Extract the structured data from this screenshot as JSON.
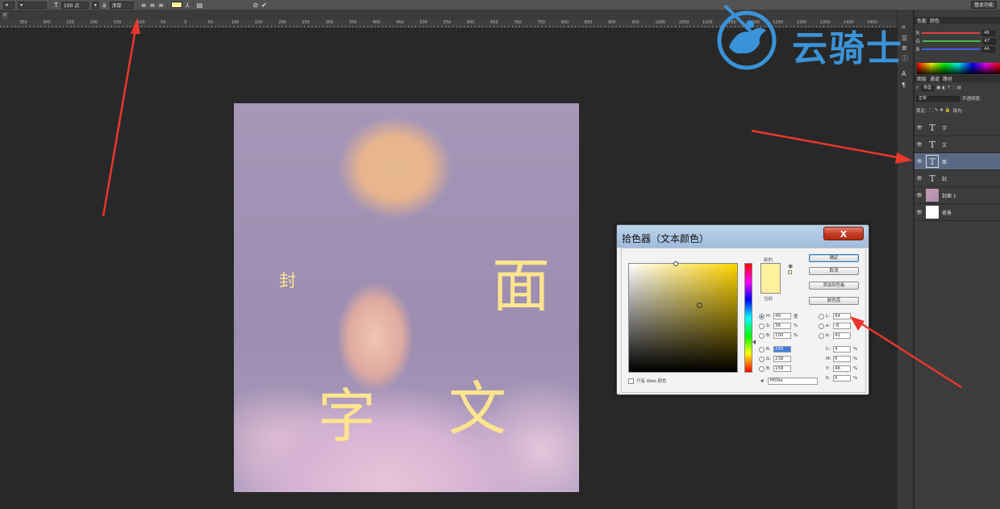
{
  "options_bar": {
    "font_size": "100 点",
    "antialias": "浑厚",
    "workspace": "基本功能",
    "text_color": "#fff09e"
  },
  "ruler": {
    "labels": [
      "350",
      "300",
      "250",
      "200",
      "150",
      "100",
      "50",
      "0",
      "50",
      "100",
      "150",
      "200",
      "250",
      "300",
      "350",
      "400",
      "450",
      "500",
      "550",
      "600",
      "650",
      "700",
      "750",
      "800",
      "850",
      "900",
      "950",
      "1000",
      "1050",
      "1100",
      "1150",
      "1200",
      "1250",
      "1300",
      "1350",
      "1400",
      "1450"
    ]
  },
  "canvas": {
    "texts": {
      "feng": "封",
      "mian": "面",
      "zi": "字",
      "wen": "文"
    },
    "text_color": "#fde48e"
  },
  "panels": {
    "top_tabs": [
      "色板",
      "颜色"
    ],
    "sliders": [
      {
        "label": "R",
        "value": "48",
        "color": "#e04040"
      },
      {
        "label": "G",
        "value": "47",
        "color": "#40c040"
      },
      {
        "label": "B",
        "value": "44",
        "color": "#4060e0"
      }
    ],
    "layer_tabs": [
      "图层",
      "通道",
      "路径"
    ],
    "kind_filter": "类型",
    "blend_mode": "正常",
    "opacity_label": "不透明度:",
    "lock_label": "锁定:",
    "fill_label": "填充:",
    "layers": [
      {
        "name": "字",
        "thumb": "T",
        "kind": "text",
        "selected": false
      },
      {
        "name": "文",
        "thumb": "T",
        "kind": "text",
        "selected": false
      },
      {
        "name": "面",
        "thumb": "T",
        "kind": "text",
        "selected": true
      },
      {
        "name": "封",
        "thumb": "T",
        "kind": "text",
        "selected": false
      },
      {
        "name": "封面 1",
        "thumb": "",
        "kind": "image",
        "selected": false
      },
      {
        "name": "背景",
        "thumb": "",
        "kind": "background",
        "selected": false
      }
    ]
  },
  "dialog": {
    "title": "拾色器（文本颜色）",
    "close": "X",
    "label_new": "新的",
    "label_current": "当前",
    "buttons": {
      "ok": "确定",
      "cancel": "取消",
      "add_swatch": "添加到色板",
      "color_library": "颜色库"
    },
    "hsb": [
      {
        "label": "H:",
        "value": "49",
        "unit": "度",
        "selected": true
      },
      {
        "label": "S:",
        "value": "38",
        "unit": "%",
        "selected": false
      },
      {
        "label": "B:",
        "value": "100",
        "unit": "%",
        "selected": false
      }
    ],
    "rgb": [
      {
        "label": "R:",
        "value": "255",
        "highlight": true
      },
      {
        "label": "G:",
        "value": "238"
      },
      {
        "label": "B:",
        "value": "158"
      }
    ],
    "lab": [
      {
        "label": "L:",
        "value": "94"
      },
      {
        "label": "a:",
        "value": "-6"
      },
      {
        "label": "b:",
        "value": "41"
      }
    ],
    "cmyk": [
      {
        "label": "C:",
        "value": "4",
        "unit": "%"
      },
      {
        "label": "M:",
        "value": "6",
        "unit": "%"
      },
      {
        "label": "Y:",
        "value": "46",
        "unit": "%"
      },
      {
        "label": "K:",
        "value": "0",
        "unit": "%"
      }
    ],
    "web_only": "只有 Web 颜色",
    "hex_label": "#",
    "hex": "fff09e"
  },
  "watermark": {
    "text": "云骑士",
    "color": "#3a93d8"
  }
}
